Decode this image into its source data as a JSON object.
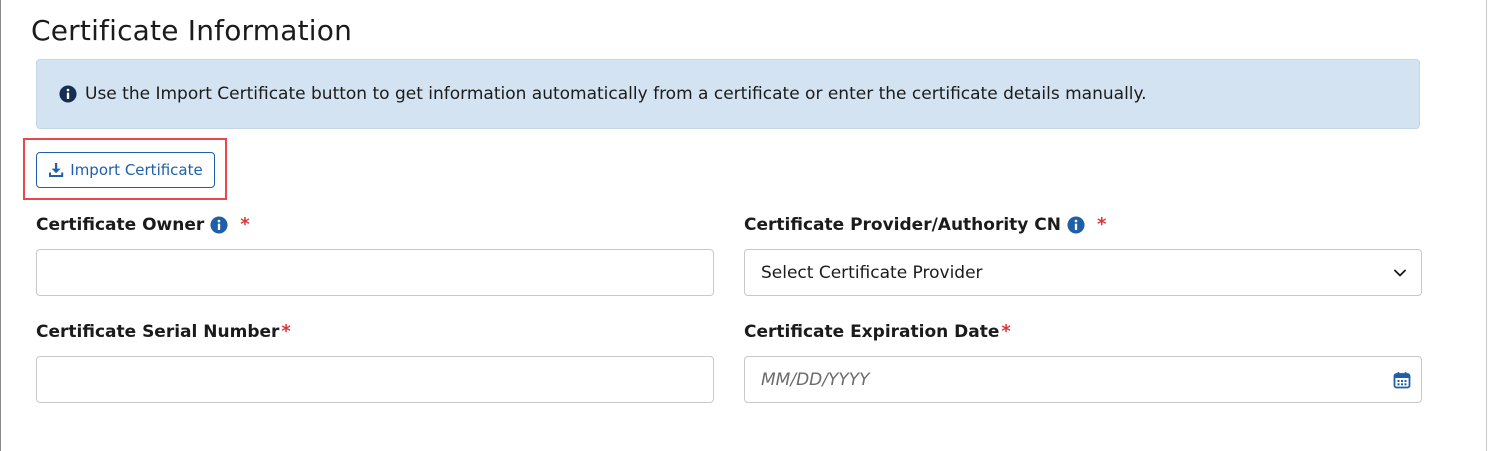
{
  "section": {
    "title": "Certificate Information"
  },
  "alert": {
    "text": "Use the Import Certificate button to get information automatically from a certificate or enter the certificate details manually."
  },
  "import_button": {
    "label": "Import Certificate",
    "icon": "download-icon"
  },
  "fields": {
    "owner": {
      "label": "Certificate Owner",
      "required_marker": "*",
      "value": "",
      "help_icon": "info-icon"
    },
    "provider": {
      "label": "Certificate Provider/Authority CN",
      "required_marker": "*",
      "selected": "Select Certificate Provider",
      "help_icon": "info-icon",
      "chevron_icon": "chevron-down-icon"
    },
    "serial": {
      "label": "Certificate Serial Number",
      "required_marker": "*",
      "value": ""
    },
    "expiration": {
      "label": "Certificate Expiration Date",
      "required_marker": "*",
      "placeholder": "MM/DD/YYYY",
      "calendar_icon": "calendar-icon"
    }
  },
  "colors": {
    "accent": "#1f5fa8",
    "alert_bg": "#d3e3f1",
    "required": "#d6373b",
    "highlight": "#e8484b"
  }
}
